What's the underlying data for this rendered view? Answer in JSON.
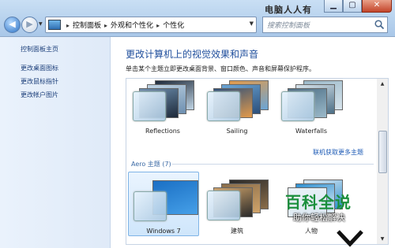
{
  "window": {
    "watermark": "电脑人人有",
    "controls": {
      "minimize": "▁",
      "maximize": "▢",
      "close": "✕"
    }
  },
  "address": {
    "breadcrumbs": [
      "控制面板",
      "外观和个性化",
      "个性化"
    ],
    "search_placeholder": "搜索控制面板"
  },
  "sidebar": {
    "items": [
      {
        "label": "控制面板主页"
      },
      {
        "label": "更改桌面图标"
      },
      {
        "label": "更改鼠标指针"
      },
      {
        "label": "更改帐户图片"
      }
    ]
  },
  "main": {
    "title": "更改计算机上的视觉效果和声音",
    "subtitle": "单击某个主题立即更改桌面背景、窗口颜色、声音和屏幕保护程序。",
    "get_more_link": "联机获取更多主题",
    "aero_section": "Aero 主题 (7)",
    "my_themes": [
      {
        "name": "Reflections",
        "colors": [
          "#1e2a3a",
          "#c0d4e4",
          "#6d8fb0"
        ]
      },
      {
        "name": "Sailing",
        "colors": [
          "#e39a4a",
          "#6aa5d6",
          "#2c4f7a"
        ]
      },
      {
        "name": "Waterfalls",
        "colors": [
          "#9bb9c9",
          "#d8e4ec",
          "#4d6f86"
        ]
      }
    ],
    "aero_themes": [
      {
        "name": "Windows 7",
        "colors": [
          "#1a6fc4",
          "#46a0e8",
          "#0d4f9b"
        ]
      },
      {
        "name": "建筑",
        "colors": [
          "#2a2a2a",
          "#8a6d4a",
          "#cfa36a"
        ]
      },
      {
        "name": "人物",
        "colors": [
          "#dce8f2",
          "#2d8fd0",
          "#e9f2f8"
        ]
      }
    ]
  },
  "overlay": {
    "brand": "百科全说",
    "tagline": "助你轻松解决"
  },
  "colors": {
    "accent": "#1f4e9c",
    "link": "#1c5ab5",
    "brand_green": "#1b8f3c"
  }
}
